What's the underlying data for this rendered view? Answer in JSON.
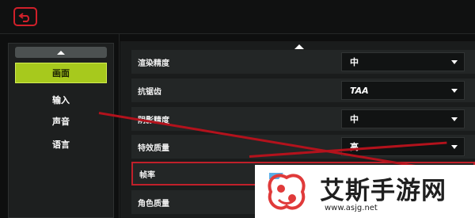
{
  "sidebar": {
    "items": [
      {
        "label": "画面",
        "active": true
      },
      {
        "label": "输入",
        "active": false
      },
      {
        "label": "声音",
        "active": false
      },
      {
        "label": "语言",
        "active": false
      }
    ]
  },
  "settings": {
    "rows": [
      {
        "label": "渲染精度",
        "value": "中",
        "has_dropdown": true
      },
      {
        "label": "抗锯齿",
        "value": "TAA",
        "has_dropdown": true
      },
      {
        "label": "阴影精度",
        "value": "中",
        "has_dropdown": true
      },
      {
        "label": "特效质量",
        "value": "高",
        "has_dropdown": true
      },
      {
        "label": "帧率",
        "value": "",
        "has_dropdown": false,
        "highlighted": true
      },
      {
        "label": "角色质量",
        "value": "",
        "has_dropdown": false
      }
    ]
  },
  "watermark": {
    "title": "艾斯手游网",
    "url": "www.asjg.net"
  },
  "icons": {
    "back": "back-arrow-icon",
    "scroll_up": "chevron-up-icon",
    "dropdown": "caret-down-icon"
  },
  "colors": {
    "accent_active": "#a7c91d",
    "highlight_red": "#c0202a",
    "background": "#0e0f0f"
  }
}
